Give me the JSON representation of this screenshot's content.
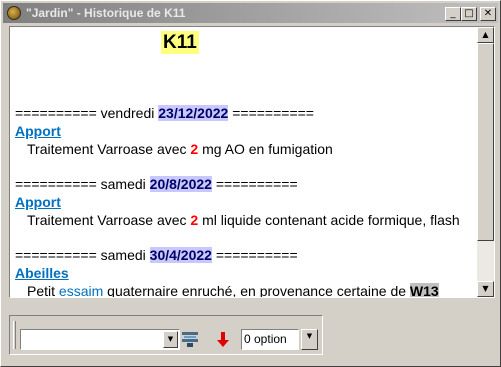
{
  "window": {
    "title": "\"Jardin\" - Historique de K11",
    "buttons": {
      "minimize": "_",
      "maximize": "□",
      "close": "✕"
    }
  },
  "history": {
    "hive": "K11",
    "entries": [
      {
        "separator_left": "========== vendredi ",
        "date": "23/12/2022",
        "separator_right": " ==========",
        "category": "Apport",
        "text_before": "Traitement Varroase avec ",
        "highlight": "2",
        "text_after": " mg AO en fumigation"
      },
      {
        "separator_left": "========== samedi ",
        "date": "20/8/2022",
        "separator_right": " ==========",
        "category": "Apport",
        "text_before": "Traitement Varroase avec ",
        "highlight": "2",
        "text_after": " ml liquide contenant acide formique, flash"
      },
      {
        "separator_left": "========== samedi ",
        "date": "30/4/2022",
        "separator_right": " ==========",
        "category": "Abeilles",
        "text_before": "Petit ",
        "highlight_blue": "essaim",
        "text_middle": " quaternaire enruché, en provenance certaine de ",
        "ref": "W13"
      }
    ]
  },
  "scrollbar": {
    "up": "▲",
    "down": "▼"
  },
  "toolbar": {
    "combo_value": "",
    "combo_arrow": "▼",
    "option_value": "0 option",
    "option_button": "▼"
  },
  "colors": {
    "date_bg": "#c8c8ff",
    "category": "#0070c0",
    "highlight_number": "#ff0000",
    "hive_badge_bg": "#ffff80"
  },
  "icons": {
    "app": "hive-app-icon",
    "filter": "filter-icon",
    "down_arrow": "red-down-arrow-icon"
  }
}
